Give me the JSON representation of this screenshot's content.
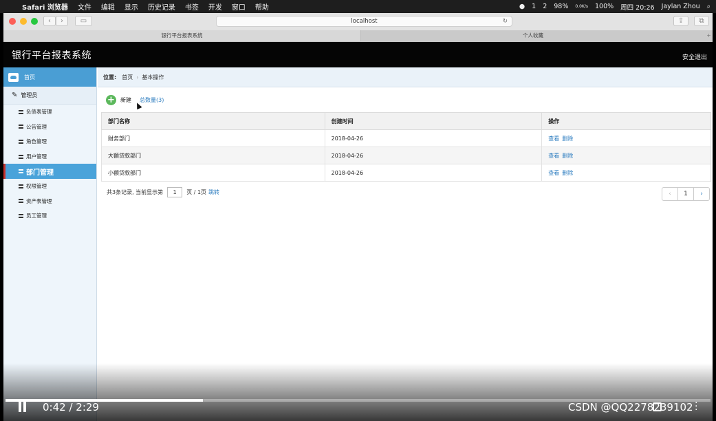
{
  "menubar": {
    "app_name": "Safari 浏览器",
    "items": [
      "文件",
      "编辑",
      "显示",
      "历史记录",
      "书签",
      "开发",
      "窗口",
      "帮助"
    ],
    "status": {
      "wechat_count": "1",
      "qq_count": "2",
      "cpu": "98%",
      "net_up": "0.0K/s",
      "net_down": "0.0K/s",
      "battery": "100%",
      "datetime": "周四 20:26",
      "user": "Jaylan Zhou"
    }
  },
  "browser": {
    "url": "localhost",
    "tabs": [
      {
        "label": "银行平台报表系统",
        "active": true
      },
      {
        "label": "个人收藏",
        "active": false
      }
    ],
    "new_tab": "+"
  },
  "header": {
    "title": "银行平台报表系统",
    "logout": "安全退出"
  },
  "sidebar": {
    "home": "首页",
    "section": "管理员",
    "items": [
      {
        "label": "负债表管理",
        "active": false
      },
      {
        "label": "公告管理",
        "active": false
      },
      {
        "label": "角色管理",
        "active": false
      },
      {
        "label": "用户管理",
        "active": false
      },
      {
        "label": "部门管理",
        "active": true
      },
      {
        "label": "权限管理",
        "active": false
      },
      {
        "label": "资产表管理",
        "active": false
      },
      {
        "label": "员工管理",
        "active": false
      }
    ]
  },
  "breadcrumb": {
    "label": "位置:",
    "items": [
      "首页",
      "基本操作"
    ]
  },
  "toolbar": {
    "new_label": "新建",
    "total": "总数量(3)"
  },
  "table": {
    "columns": [
      "部门名称",
      "创建时间",
      "操作"
    ],
    "rows": [
      {
        "name": "财务部门",
        "created": "2018-04-26",
        "view": "查看",
        "delete": "删除"
      },
      {
        "name": "大额贷款部门",
        "created": "2018-04-26",
        "view": "查看",
        "delete": "删除"
      },
      {
        "name": "小额贷款部门",
        "created": "2018-04-26",
        "view": "查看",
        "delete": "删除"
      }
    ]
  },
  "pager": {
    "summary": "共3条记录, 当前显示第",
    "page_value": "1",
    "suffix": "页 / 1页",
    "jump": "跳转",
    "prev": "‹",
    "current": "1",
    "next": "›"
  },
  "video": {
    "time": "0:42 / 2:29",
    "watermark": "CSDN @QQ2278239102",
    "progress_fraction": 0.28
  },
  "colors": {
    "header_bg": "#050505",
    "sidebar_active": "#4aa3da",
    "link": "#2a7bbf",
    "add_green": "#5cb85c"
  }
}
